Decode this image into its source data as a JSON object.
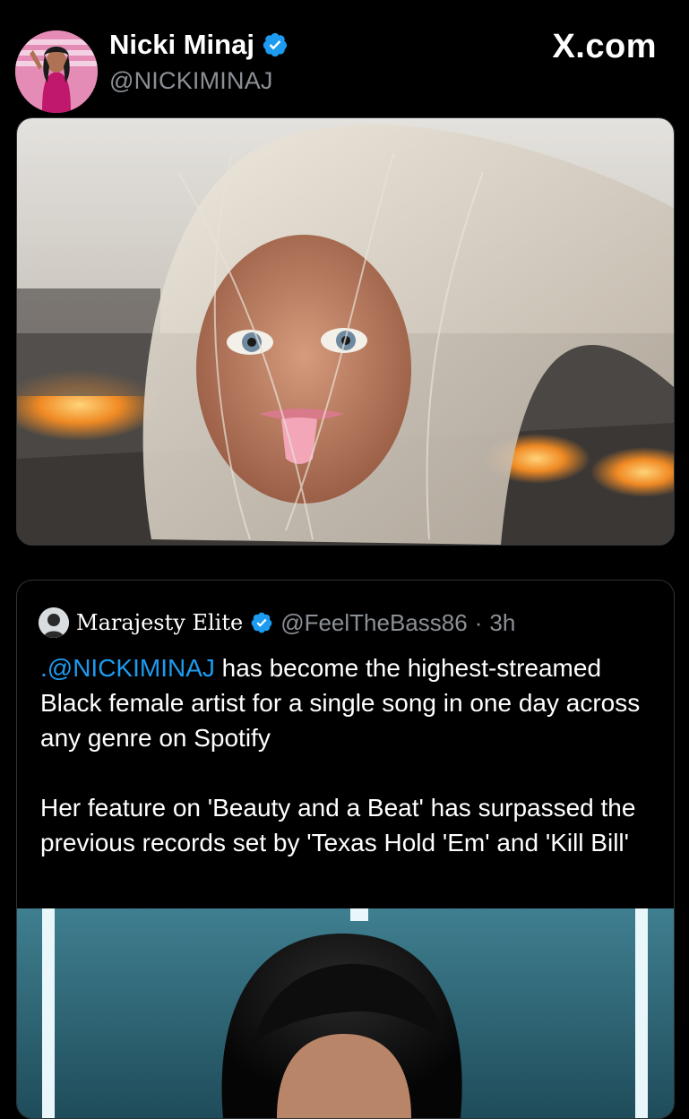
{
  "author": {
    "display_name": "Nicki Minaj",
    "handle": "@NICKIMINAJ",
    "verified": true,
    "avatar_icon": "profile-avatar"
  },
  "brand": {
    "label": "X.com"
  },
  "media": {
    "icon": "photo-doll-face-fire-highway"
  },
  "quoted_post": {
    "author_name": "Marajesty Elite",
    "handle": "@FeelTheBass86",
    "separator": "·",
    "time": "3h",
    "verified": true,
    "mention": ".@NICKIMINAJ",
    "text_line1_rest": " has become the highest-streamed Black female artist for a single song in one day across any genre on Spotify",
    "text_paragraph2": "Her feature on 'Beauty and a Beat' has surpassed the previous records set by 'Texas Hold 'Em' and 'Kill Bill'",
    "media_icon": "photo-woman-dark-bangs-stage"
  },
  "colors": {
    "background": "#000000",
    "text": "#ffffff",
    "secondary_text": "#8b9096",
    "link": "#1d9bf0",
    "verified_badge": "#1d9bf0",
    "border": "#2f3336"
  }
}
